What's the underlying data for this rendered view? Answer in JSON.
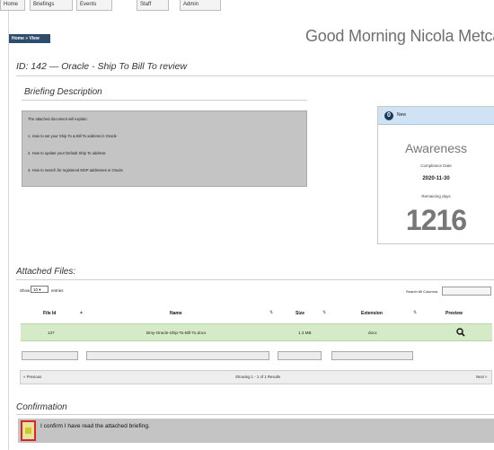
{
  "nav": {
    "tabs": [
      {
        "label": "Home"
      },
      {
        "label": "Briefings"
      },
      {
        "label": "Events"
      },
      {
        "label": "Staff"
      },
      {
        "label": "Admin"
      }
    ]
  },
  "breadcrumb": "Home » View",
  "greeting": "Good Morning Nicola Metcalfe",
  "page": {
    "title": "ID: 142 — Oracle - Ship To Bill To review"
  },
  "briefing": {
    "section_title": "Briefing Description",
    "lines": [
      "The attached document will explain:",
      "1. How to set your Ship To & Bill To address in Oracle",
      "2. How to update your Default Ship To address",
      "3. How to search for registered MSP addresses in Oracle"
    ]
  },
  "status_card": {
    "header_icon_glyph": "0",
    "header_label": "New",
    "type": "Awareness",
    "compliance_label": "Compliance Date",
    "compliance_date": "2020-11-30",
    "remaining_label": "Remaining days",
    "remaining_days": "1216",
    "colors": {
      "header_bg": "#cfe3f5",
      "icon_bg": "#1b3a5c"
    }
  },
  "files": {
    "section_title": "Attached Files:",
    "show_label": "Show",
    "entries_value": "10",
    "entries_label": "entries",
    "search_label": "Search All Columns:",
    "search_value": "",
    "columns": {
      "file_id": "File Id",
      "name": "Name",
      "size": "Size",
      "extension": "Extension",
      "preview": "Preview"
    },
    "rows": [
      {
        "file_id": "137",
        "name": "Bmy-Oracle-Ship-To-Bill-To.docx",
        "size": "1.3 MB",
        "extension": "docx",
        "preview_icon": "search-icon"
      }
    ],
    "pager": {
      "previous": "« Previous",
      "info": "Showing 1 - 1 of 1 Results",
      "next": "Next »"
    },
    "row_color": "#d5ebc7"
  },
  "confirmation": {
    "section_title": "Confirmation",
    "label": "I confirm I have read the attached briefing.",
    "highlight_color": "#d8252a"
  }
}
